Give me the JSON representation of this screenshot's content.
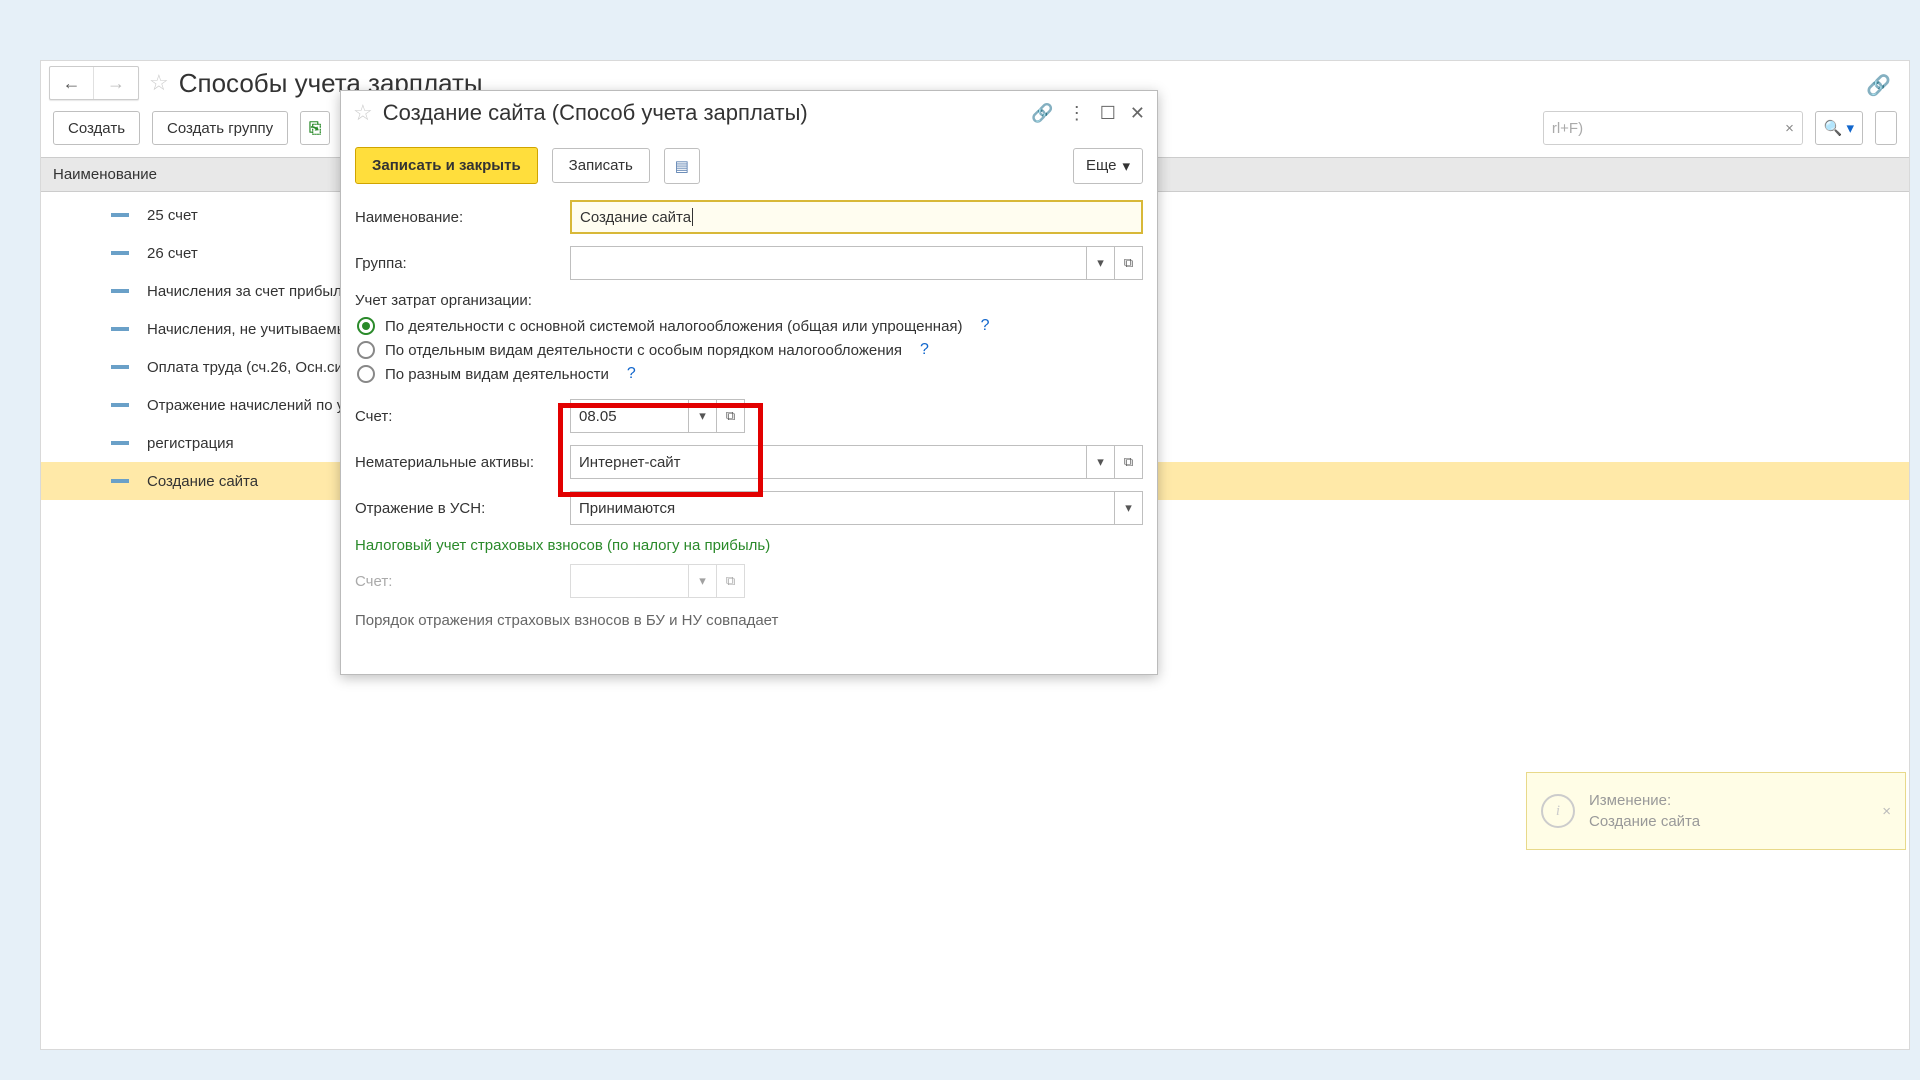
{
  "main": {
    "title": "Способы учета зарплаты",
    "toolbar": {
      "create": "Создать",
      "create_group": "Создать группу",
      "search_placeholder": "rl+F)"
    },
    "column_header": "Наименование",
    "rows": [
      "25 счет",
      "26 счет",
      "Начисления за счет прибыл",
      "Начисления, не учитываемы",
      "Оплата труда (сч.26, Осн.си",
      "Отражение начислений по у",
      "регистрация",
      "Создание сайта"
    ],
    "selected_index": 7
  },
  "dialog": {
    "title": "Создание сайта (Способ учета зарплаты)",
    "toolbar": {
      "save_close": "Записать и закрыть",
      "save": "Записать",
      "more": "Еще"
    },
    "fields": {
      "name_label": "Наименование:",
      "name_value": "Создание сайта",
      "group_label": "Группа:",
      "group_value": "",
      "section_title": "Учет затрат организации:",
      "radio1": "По деятельности с основной системой налогообложения (общая или упрощенная)",
      "radio2": "По отдельным видам деятельности с особым порядком налогообложения",
      "radio3": "По разным видам деятельности",
      "account_label": "Счет:",
      "account_value": "08.05",
      "asset_label": "Нематериальные активы:",
      "asset_value": "Интернет-сайт",
      "usn_label": "Отражение в УСН:",
      "usn_value": "Принимаются",
      "tax_link": "Налоговый учет страховых взносов (по налогу на прибыль)",
      "tax_account_label": "Счет:",
      "tax_account_value": "",
      "order_note": "Порядок отражения страховых взносов в БУ и НУ совпадает"
    }
  },
  "notification": {
    "title": "Изменение:",
    "subtitle": "Создание сайта"
  }
}
